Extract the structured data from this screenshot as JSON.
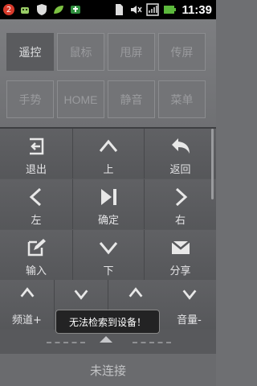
{
  "status_bar": {
    "notification_count": "2",
    "time": "11:39"
  },
  "tabs_row1": [
    {
      "label": "遥控",
      "active": true
    },
    {
      "label": "鼠标",
      "active": false
    },
    {
      "label": "甩屏",
      "active": false
    },
    {
      "label": "传屏",
      "active": false
    }
  ],
  "tabs_row2": [
    {
      "label": "手势"
    },
    {
      "label": "HOME"
    },
    {
      "label": "静音"
    },
    {
      "label": "菜单"
    }
  ],
  "remote": {
    "back_out": "退出",
    "up": "上",
    "return": "返回",
    "left": "左",
    "ok": "确定",
    "right": "右",
    "input": "输入",
    "down": "下",
    "share": "分享",
    "channel_plus": "频道+",
    "volume_minus": "音量-"
  },
  "toast": "无法检索到设备！",
  "connection_status": "未连接"
}
